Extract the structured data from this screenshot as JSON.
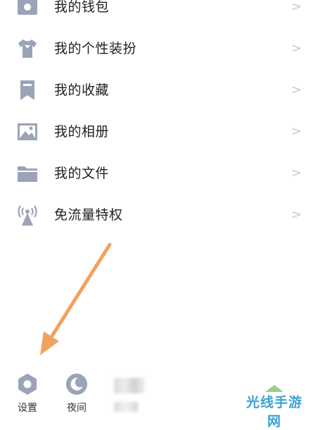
{
  "menu": {
    "items": [
      {
        "label": "我的钱包",
        "icon": "wallet-icon"
      },
      {
        "label": "我的个性装扮",
        "icon": "tshirt-icon"
      },
      {
        "label": "我的收藏",
        "icon": "bookmark-icon"
      },
      {
        "label": "我的相册",
        "icon": "photo-icon"
      },
      {
        "label": "我的文件",
        "icon": "folder-icon"
      },
      {
        "label": "免流量特权",
        "icon": "signal-tower-icon"
      }
    ],
    "chevron": ">"
  },
  "bottom_bar": {
    "settings_label": "设置",
    "night_label": "夜间"
  },
  "colors": {
    "icon": "#9aa3b8",
    "arrow": "#f0a35e",
    "chevron": "#c8c8c8",
    "watermark": "#3aa3d6"
  },
  "watermark": "光线手游网"
}
